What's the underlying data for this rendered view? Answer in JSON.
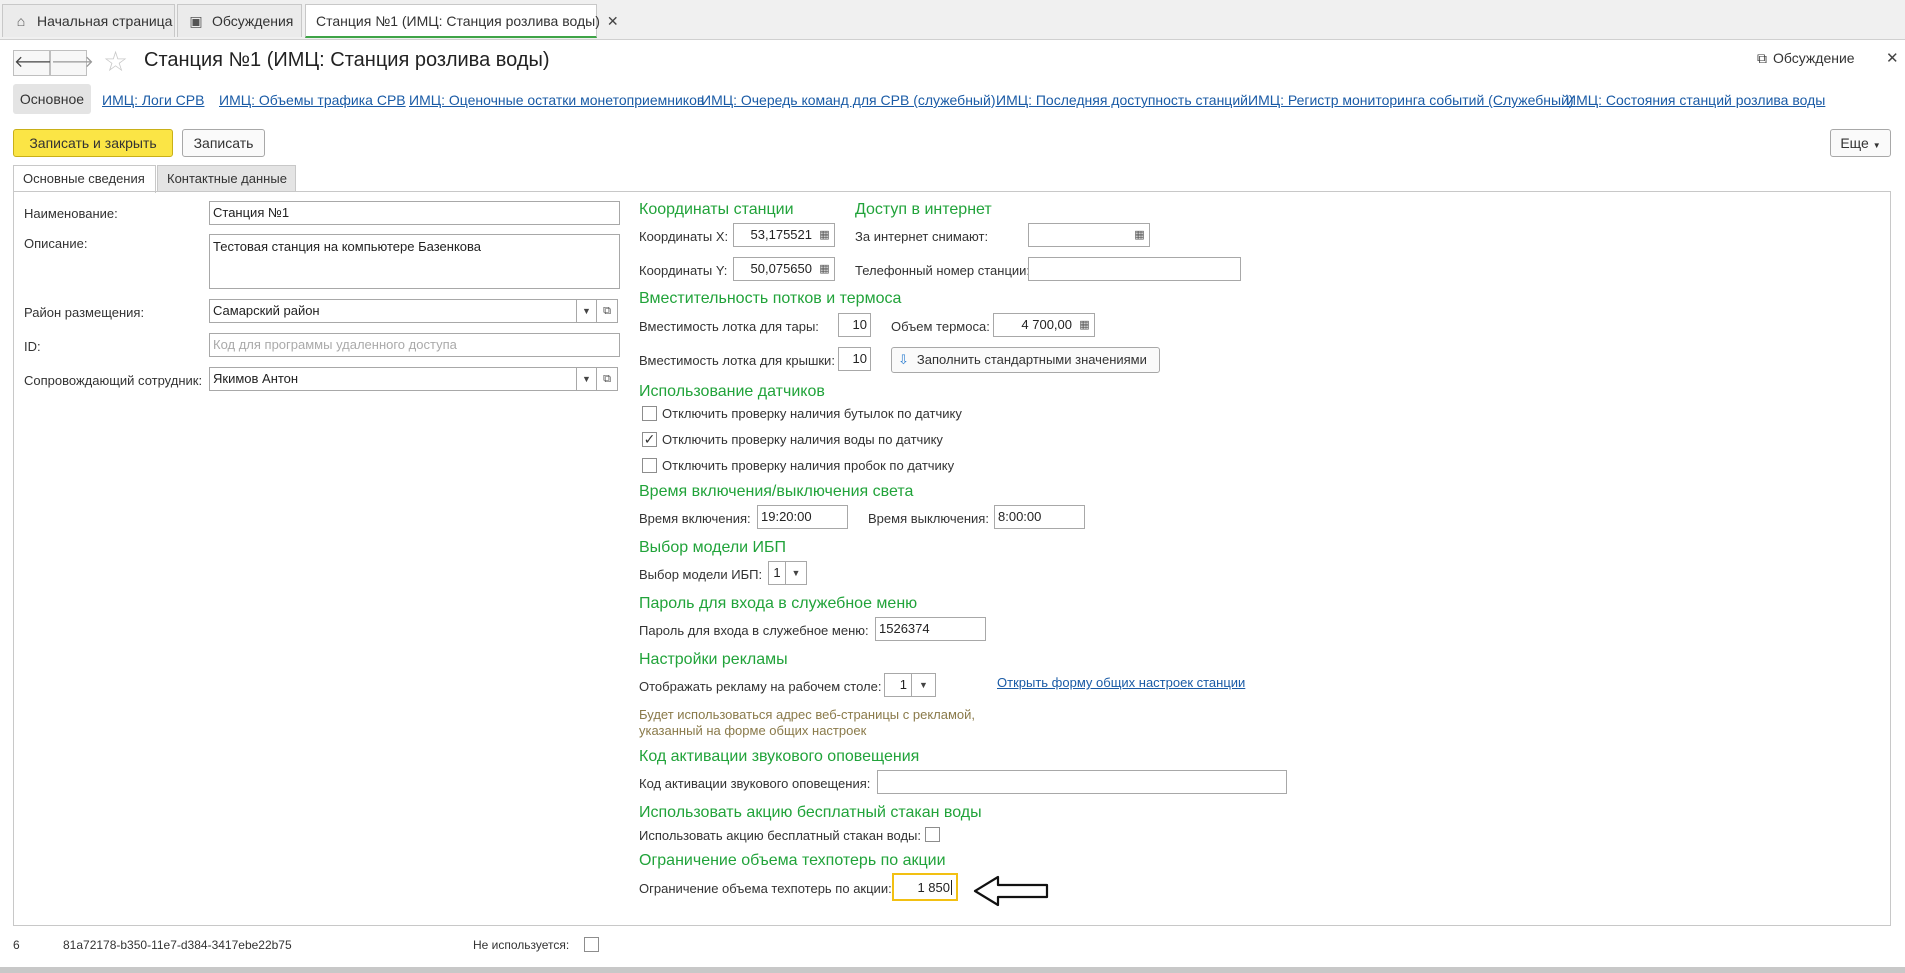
{
  "tabs": [
    {
      "label": "Начальная страница",
      "icon": "home-icon"
    },
    {
      "label": "Обсуждения",
      "icon": "chat-icon"
    },
    {
      "label": "Станция №1 (ИМЦ: Станция розлива воды)",
      "icon": "close-icon"
    }
  ],
  "header": {
    "title": "Станция №1 (ИМЦ: Станция розлива воды)",
    "discussion": "Обсуждение"
  },
  "nav": {
    "main": "Основное",
    "links": [
      "ИМЦ: Логи СРВ",
      "ИМЦ: Объемы трафика СРВ",
      "ИМЦ: Оценочные остатки монетоприемников",
      "ИМЦ: Очередь команд для СРВ (служебный)",
      "ИМЦ: Последняя доступность станций",
      "ИМЦ: Регистр мониторинга событий (Служебный)",
      "ИМЦ: Состояния станций розлива воды"
    ]
  },
  "toolbar": {
    "save_close": "Записать и закрыть",
    "save": "Записать",
    "more": "Еще"
  },
  "formtabs": [
    "Основные сведения",
    "Контактные данные"
  ],
  "left": {
    "name_label": "Наименование:",
    "name_value": "Станция №1",
    "desc_label": "Описание:",
    "desc_value": "Тестовая станция на компьютере Базенкова",
    "district_label": "Район размещения:",
    "district_value": "Самарский район",
    "id_label": "ID:",
    "id_placeholder": "Код для программы удаленного доступа",
    "employee_label": "Сопровождающий сотрудник:",
    "employee_value": "Якимов Антон"
  },
  "coords": {
    "title": "Координаты станции",
    "x_label": "Координаты X:",
    "x_value": "53,175521",
    "y_label": "Координаты Y:",
    "y_value": "50,075650"
  },
  "internet": {
    "title": "Доступ в интернет",
    "charge_label": "За интернет снимают:",
    "charge_value": "",
    "phone_label": "Телефонный номер станции:",
    "phone_value": ""
  },
  "capacity": {
    "title": "Вместительность потков и термоса",
    "tray_label": "Вместимость лотка для тары:",
    "tray_value": "10",
    "thermos_label": "Объем термоса:",
    "thermos_value": "4 700,00",
    "lid_label": "Вместимость лотка для крышки:",
    "lid_value": "10",
    "fill_button": "Заполнить стандартными значениями"
  },
  "sensors": {
    "title": "Использование датчиков",
    "items": [
      {
        "label": "Отключить проверку наличия бутылок по датчику",
        "checked": false
      },
      {
        "label": "Отключить проверку наличия воды по датчику",
        "checked": true
      },
      {
        "label": "Отключить проверку наличия пробок по датчику",
        "checked": false
      }
    ]
  },
  "light": {
    "title": "Время включения/выключения света",
    "on_label": "Время включения:",
    "on_value": "19:20:00",
    "off_label": "Время выключения:",
    "off_value": "8:00:00"
  },
  "ups": {
    "title": "Выбор модели ИБП",
    "label": "Выбор модели ИБП:",
    "value": "1"
  },
  "password": {
    "title": "Пароль для входа в служебное меню",
    "label": "Пароль для входа в служебное меню:",
    "value": "1526374"
  },
  "ads": {
    "title": "Настройки рекламы",
    "label": "Отображать рекламу на рабочем столе:",
    "value": "1",
    "link": "Открыть форму общих настроек станции",
    "note1": "Будет использоваться адрес веб-страницы с рекламой,",
    "note2": "указанный на форме общих настроек"
  },
  "sound": {
    "title": "Код активации звукового оповещения",
    "label": "Код активации звукового оповещения:",
    "value": ""
  },
  "promo": {
    "title": "Использовать акцию бесплатный стакан воды",
    "label": "Использовать акцию бесплатный стакан воды:"
  },
  "loss": {
    "title": "Ограничение объема техпотерь по акции",
    "label": "Ограничение объема техпотерь по акции:",
    "value": "1 850"
  },
  "status": {
    "code": "6",
    "guid": "81a72178-b350-11e7-d384-3417ebe22b75",
    "unused_label": "Не используется:"
  }
}
